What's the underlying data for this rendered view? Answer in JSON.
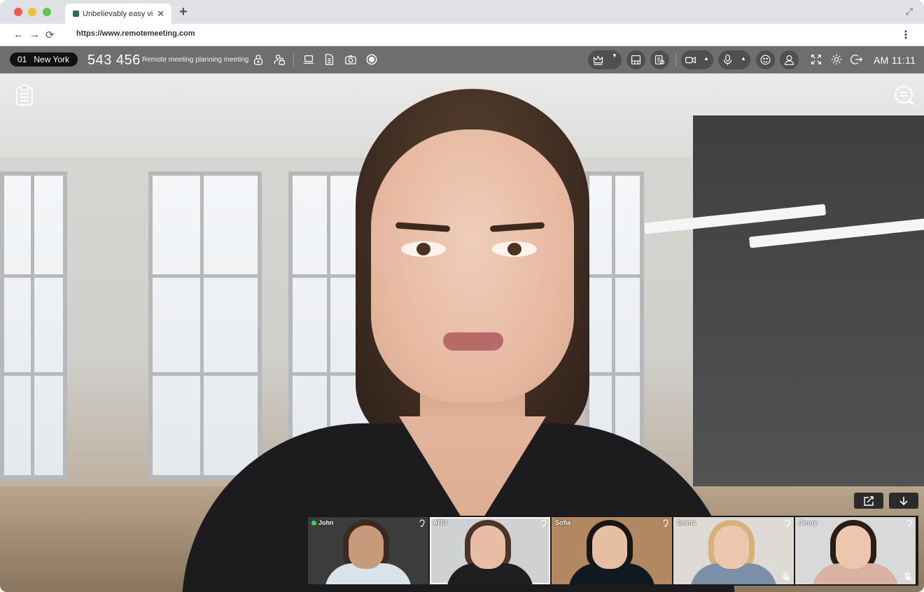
{
  "browser": {
    "tab_title": "Unbelievably easy vi...",
    "tab_close": "✕",
    "new_tab": "+",
    "url": "https://www.remotemeeting.com",
    "nav": {
      "back": "←",
      "forward": "→",
      "reload": "⟳",
      "menu": "⋮",
      "expand": "⤢"
    }
  },
  "toolbar": {
    "room_number": "01",
    "room_name": "New York",
    "meeting_id": "543 456",
    "meeting_title": "Remote meeting planning meeting",
    "clock": "AM 11:11",
    "left_icons": [
      "lock-icon",
      "user-lock-icon",
      "laptop-icon",
      "document-icon",
      "camera-icon",
      "record-icon"
    ],
    "right_icons": [
      "crown-icon",
      "layout-icon",
      "list-icon",
      "video-icon",
      "microphone-icon",
      "emoji-icon",
      "participant-icon",
      "fullscreen-icon",
      "gear-icon",
      "exit-icon"
    ]
  },
  "stage": {
    "left_overlay_icon": "clipboard-icon",
    "right_overlay_icon": "chat-icon",
    "thumb_actions": [
      "share-out-icon",
      "download-icon"
    ]
  },
  "participants": [
    {
      "name": "John",
      "host": true,
      "muted": false,
      "skin": "#c89a7c",
      "hair": "#3b2a20",
      "shirt": "#d9e4ea",
      "bg": "#3c3c3c"
    },
    {
      "name": "ARU",
      "host": false,
      "muted": false,
      "skin": "#e8bda5",
      "hair": "#4a3426",
      "shirt": "#1f1f20",
      "bg": "#cfd1d3",
      "selected": true
    },
    {
      "name": "Sofia",
      "host": false,
      "muted": false,
      "skin": "#e6bfa3",
      "hair": "#1a1412",
      "shirt": "#101820",
      "bg": "#b18860"
    },
    {
      "name": "Emma",
      "host": false,
      "muted": true,
      "skin": "#ecc7ad",
      "hair": "#d8b07a",
      "shirt": "#7b8fa8",
      "bg": "#dedbd6"
    },
    {
      "name": "Jenny",
      "host": false,
      "muted": true,
      "skin": "#ecc6ae",
      "hair": "#2a1d17",
      "shirt": "#d9b3a0",
      "bg": "#d8d9d8"
    }
  ]
}
